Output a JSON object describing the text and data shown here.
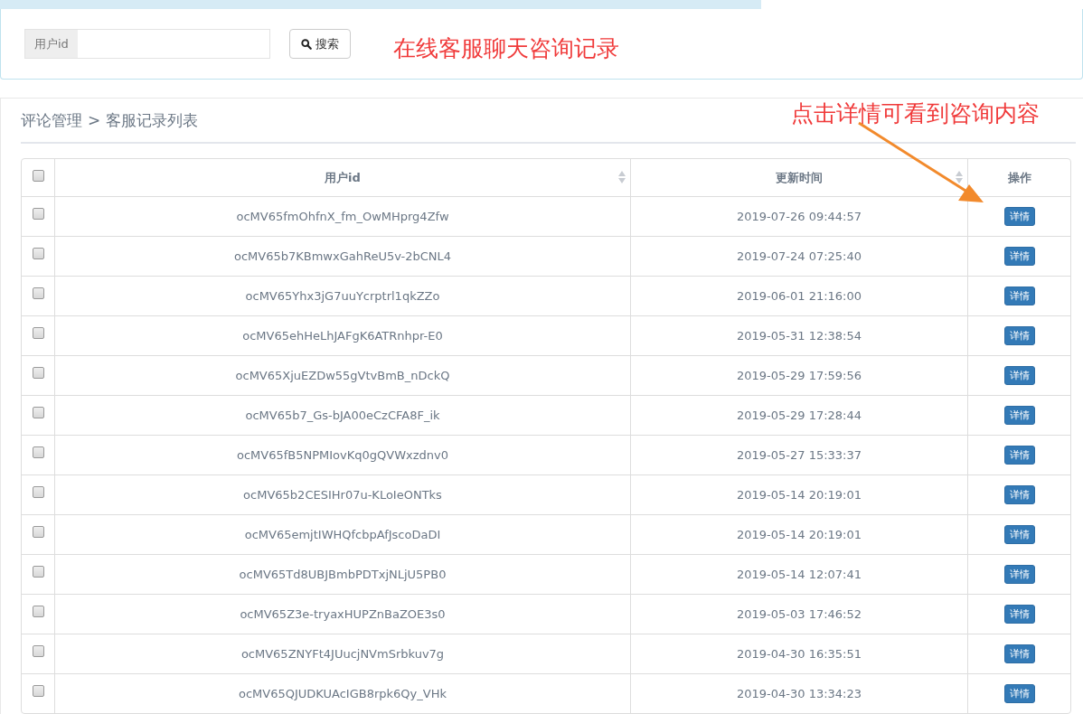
{
  "search": {
    "label": "用户id",
    "button": "搜索"
  },
  "annotation_title": "在线客服聊天咨询记录",
  "breadcrumb": {
    "parent": "评论管理",
    "separator": ">",
    "current": "客服记录列表"
  },
  "annotation_hint": "点击详情可看到咨询内容",
  "table": {
    "select_all": {
      "checked": false
    },
    "columns": [
      {
        "label": "用户id",
        "sortable": true
      },
      {
        "label": "更新时间",
        "sortable": true
      },
      {
        "label": "操作",
        "sortable": false
      }
    ],
    "rows": [
      {
        "checked": false,
        "user_id": "ocMV65fmOhfnX_fm_OwMHprg4Zfw",
        "updated": "2019-07-26 09:44:57",
        "action": "详情"
      },
      {
        "checked": false,
        "user_id": "ocMV65b7KBmwxGahReU5v-2bCNL4",
        "updated": "2019-07-24 07:25:40",
        "action": "详情"
      },
      {
        "checked": false,
        "user_id": "ocMV65Yhx3jG7uuYcrptrl1qkZZo",
        "updated": "2019-06-01 21:16:00",
        "action": "详情"
      },
      {
        "checked": false,
        "user_id": "ocMV65ehHeLhJAFgK6ATRnhpr-E0",
        "updated": "2019-05-31 12:38:54",
        "action": "详情"
      },
      {
        "checked": false,
        "user_id": "ocMV65XjuEZDw55gVtvBmB_nDckQ",
        "updated": "2019-05-29 17:59:56",
        "action": "详情"
      },
      {
        "checked": false,
        "user_id": "ocMV65b7_Gs-bJA00eCzCFA8F_ik",
        "updated": "2019-05-29 17:28:44",
        "action": "详情"
      },
      {
        "checked": false,
        "user_id": "ocMV65fB5NPMIovKq0gQVWxzdnv0",
        "updated": "2019-05-27 15:33:37",
        "action": "详情"
      },
      {
        "checked": false,
        "user_id": "ocMV65b2CESIHr07u-KLoIeONTks",
        "updated": "2019-05-14 20:19:01",
        "action": "详情"
      },
      {
        "checked": false,
        "user_id": "ocMV65emjtIWHQfcbpAfJscoDaDI",
        "updated": "2019-05-14 20:19:01",
        "action": "详情"
      },
      {
        "checked": false,
        "user_id": "ocMV65Td8UBJBmbPDTxjNLjU5PB0",
        "updated": "2019-05-14 12:07:41",
        "action": "详情"
      },
      {
        "checked": false,
        "user_id": "ocMV65Z3e-tryaxHUPZnBaZOE3s0",
        "updated": "2019-05-03 17:46:52",
        "action": "详情"
      },
      {
        "checked": false,
        "user_id": "ocMV65ZNYFt4JUucjNVmSrbkuv7g",
        "updated": "2019-04-30 16:35:51",
        "action": "详情"
      },
      {
        "checked": false,
        "user_id": "ocMV65QJUDKUAcIGB8rpk6Qy_VHk",
        "updated": "2019-04-30 13:34:23",
        "action": "详情"
      }
    ]
  }
}
